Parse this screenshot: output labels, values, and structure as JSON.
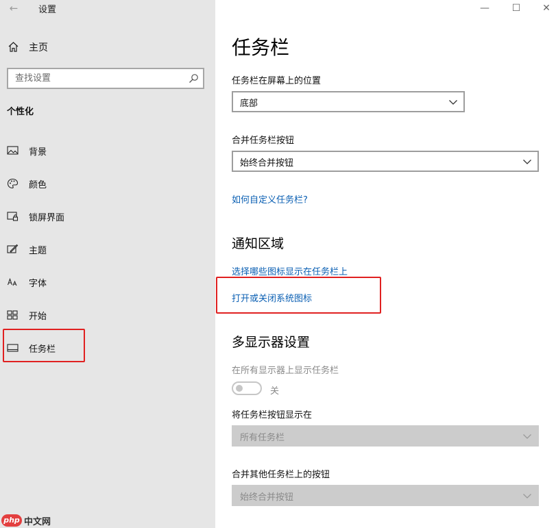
{
  "window": {
    "title": "设置",
    "back_glyph": "←",
    "minimize_glyph": "—",
    "maximize_glyph": "☐",
    "close_glyph": "✕"
  },
  "sidebar": {
    "home_label": "主页",
    "search_placeholder": "查找设置",
    "section_title": "个性化",
    "items": [
      {
        "label": "背景",
        "icon": "picture-icon"
      },
      {
        "label": "颜色",
        "icon": "palette-icon"
      },
      {
        "label": "锁屏界面",
        "icon": "lock-screen-icon"
      },
      {
        "label": "主题",
        "icon": "theme-icon"
      },
      {
        "label": "字体",
        "icon": "font-icon"
      },
      {
        "label": "开始",
        "icon": "start-icon"
      },
      {
        "label": "任务栏",
        "icon": "taskbar-icon",
        "selected": true
      }
    ]
  },
  "main": {
    "title": "任务栏",
    "position_label": "任务栏在屏幕上的位置",
    "position_value": "底部",
    "combine_label": "合并任务栏按钮",
    "combine_value": "始终合并按钮",
    "customize_link": "如何自定义任务栏?",
    "notification_heading": "通知区域",
    "notification_links": [
      "选择哪些图标显示在任务栏上",
      "打开或关闭系统图标"
    ],
    "multi_display_heading": "多显示器设置",
    "show_on_all_label": "在所有显示器上显示任务栏",
    "show_on_all_state": "关",
    "show_buttons_label": "将任务栏按钮显示在",
    "show_buttons_value": "所有任务栏",
    "combine_other_label": "合并其他任务栏上的按钮",
    "combine_other_value": "始终合并按钮"
  },
  "watermark": {
    "badge": "php",
    "text": "中文网"
  },
  "colors": {
    "sidebar_bg": "#e6e6e6",
    "link": "#0a5fb3",
    "annotation_red": "#e02020",
    "disabled_bg": "#cccccc"
  }
}
